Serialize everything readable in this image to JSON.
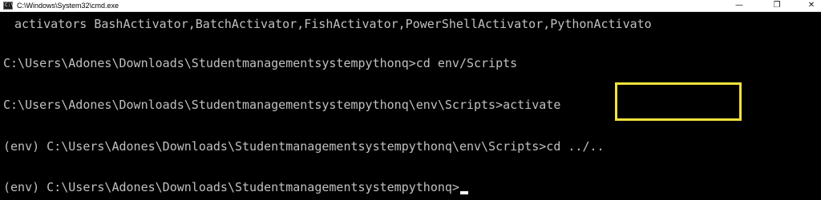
{
  "window": {
    "title": "C:\\Windows\\System32\\cmd.exe",
    "icon": "cmd-icon",
    "icon_glyph": "C:\\",
    "controls": {
      "minimize": "—",
      "maximize": "❐",
      "close": "✕"
    }
  },
  "console": {
    "lines": [
      "activators BashActivator,BatchActivator,FishActivator,PowerShellActivator,PythonActivato",
      "C:\\Users\\Adones\\Downloads\\Studentmanagementsystempythonq>cd env/Scripts",
      "C:\\Users\\Adones\\Downloads\\Studentmanagementsystempythonq\\env\\Scripts>activate",
      "(env) C:\\Users\\Adones\\Downloads\\Studentmanagementsystempythonq\\env\\Scripts>cd ../..",
      "(env) C:\\Users\\Adones\\Downloads\\Studentmanagementsystempythonq>"
    ],
    "highlight_color": "#f2e33a",
    "text_color": "#c0c0c0",
    "background": "#000000"
  }
}
